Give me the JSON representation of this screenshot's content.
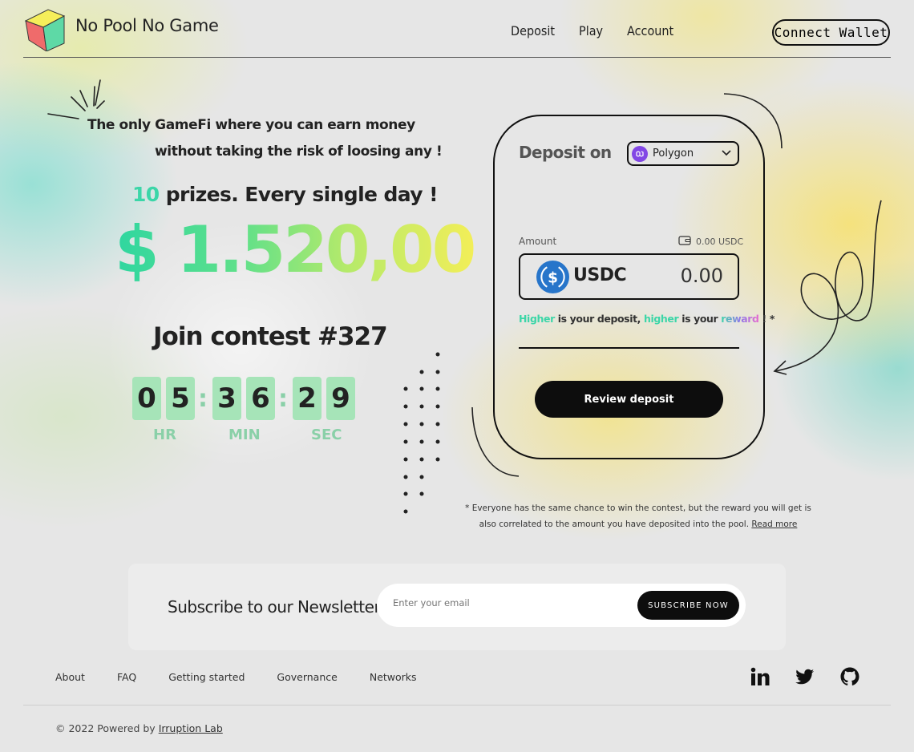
{
  "header": {
    "brand": "No Pool No Game",
    "nav": [
      "Deposit",
      "Play",
      "Account"
    ],
    "connect_label": "Connect Wallet"
  },
  "hero": {
    "tagline_1": "The only GameFi where you can earn money",
    "tagline_2": "without taking the risk of loosing any !",
    "prizes_count": "10",
    "prizes_text": " prizes. Every single day !",
    "prize_amount": "$ 1.520,00",
    "contest_title": "Join contest #327",
    "timer": {
      "h1": "0",
      "h2": "5",
      "m1": "3",
      "m2": "6",
      "s1": "2",
      "s2": "9",
      "colon": ":",
      "hr_label": "HR",
      "min_label": "MIN",
      "sec_label": "SEC"
    }
  },
  "deposit": {
    "title": "Deposit on",
    "network": "Polygon",
    "amount_label": "Amount",
    "balance": "0.00 USDC",
    "token": "USDC",
    "amount_value": "0.00",
    "higher_1": "Higher",
    "mid_1": " is your deposit, ",
    "higher_2": "higher",
    "mid_2": " is your ",
    "reward": "reward",
    "end": " ! *",
    "review_label": "Review deposit",
    "footnote": "* Everyone has the same chance to win the contest, but the reward you will get is also correlated to the amount you have deposited into the pool.",
    "read_more": "Read more"
  },
  "newsletter": {
    "title": "Subscribe to our Newsletter",
    "placeholder": "Enter your email",
    "button": "SUBSCRIBE NOW"
  },
  "footer": {
    "links": [
      "About",
      "FAQ",
      "Getting started",
      "Governance",
      "Networks"
    ],
    "copyright_prefix": "© 2022 Powered by ",
    "copyright_link": "Irruption Lab",
    "socials": [
      "linkedin-icon",
      "twitter-icon",
      "github-icon"
    ]
  },
  "colors": {
    "accent_green": "#3cd6a8",
    "accent_yellow": "#f2ee58",
    "digit_bg": "#a6e4b8",
    "button_dark": "#0d0d0d",
    "polygon_purple": "#8247e5",
    "usdc_blue": "#2775ca"
  }
}
